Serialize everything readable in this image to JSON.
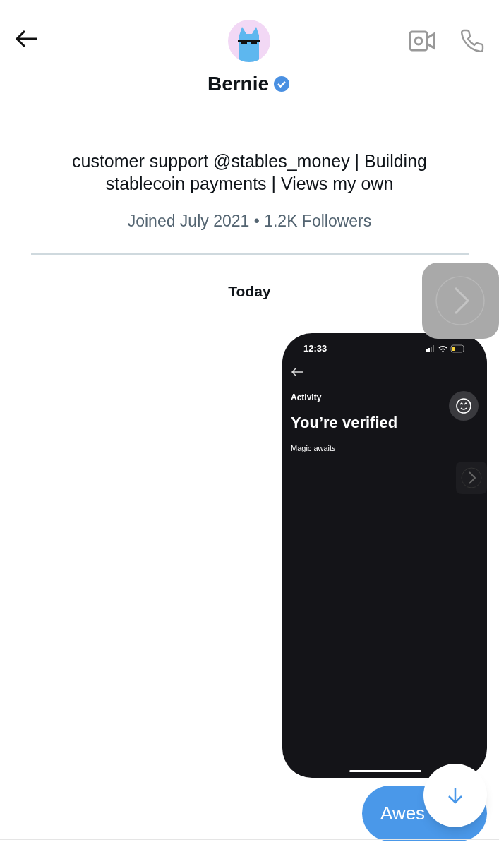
{
  "header": {
    "name": "Bernie",
    "verified": true
  },
  "profile": {
    "bio": "customer support @stables_money | Building stablecoin payments | Views my own",
    "meta": "Joined July 2021 • 1.2K Followers"
  },
  "day_label": "Today",
  "shared_screenshot": {
    "time": "12:33",
    "section": "Activity",
    "title": "You’re verified",
    "subtitle": "Magic awaits"
  },
  "message": {
    "text": "Awes"
  }
}
